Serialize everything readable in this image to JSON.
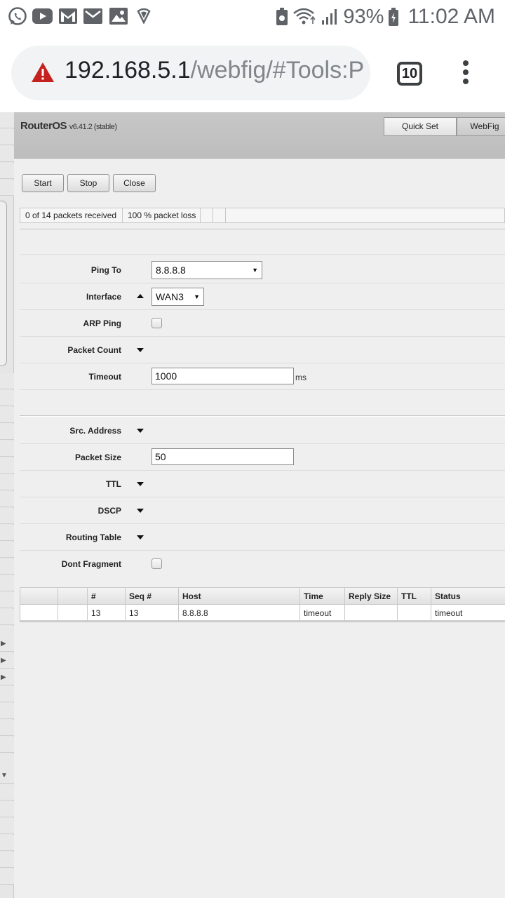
{
  "statusbar": {
    "notification_icons": [
      "whatsapp-icon",
      "youtube-icon",
      "gmail-icon",
      "email-icon",
      "gallery-icon",
      "shield-icon"
    ],
    "battery_percent": "93%",
    "time": "11:02 AM"
  },
  "browser": {
    "url_host": "192.168.5.1",
    "url_path": "/webfig/#Tools:P",
    "tab_count": "10"
  },
  "header": {
    "title": "RouterOS",
    "version": "v6.41.2 (stable)",
    "quickset_label": "Quick Set",
    "webfig_label": "WebFig"
  },
  "actions": {
    "start": "Start",
    "stop": "Stop",
    "close": "Close"
  },
  "status": {
    "received": "0 of 14 packets received",
    "loss": "100 % packet loss"
  },
  "form": {
    "ping_to": {
      "label": "Ping To",
      "value": "8.8.8.8"
    },
    "interface": {
      "label": "Interface",
      "value": "WAN3"
    },
    "arp_ping": {
      "label": "ARP Ping"
    },
    "packet_count": {
      "label": "Packet Count"
    },
    "timeout": {
      "label": "Timeout",
      "value": "1000",
      "unit": "ms"
    },
    "src_address": {
      "label": "Src. Address"
    },
    "packet_size": {
      "label": "Packet Size",
      "value": "50"
    },
    "ttl": {
      "label": "TTL"
    },
    "dscp": {
      "label": "DSCP"
    },
    "routing_table": {
      "label": "Routing Table"
    },
    "dont_fragment": {
      "label": "Dont Fragment"
    }
  },
  "table": {
    "columns": [
      "",
      "",
      "#",
      "Seq #",
      "Host",
      "Time",
      "Reply Size",
      "TTL",
      "Status"
    ],
    "rows": [
      [
        "",
        "",
        "13",
        "13",
        "8.8.8.8",
        "timeout",
        "",
        "",
        "timeout"
      ]
    ]
  }
}
